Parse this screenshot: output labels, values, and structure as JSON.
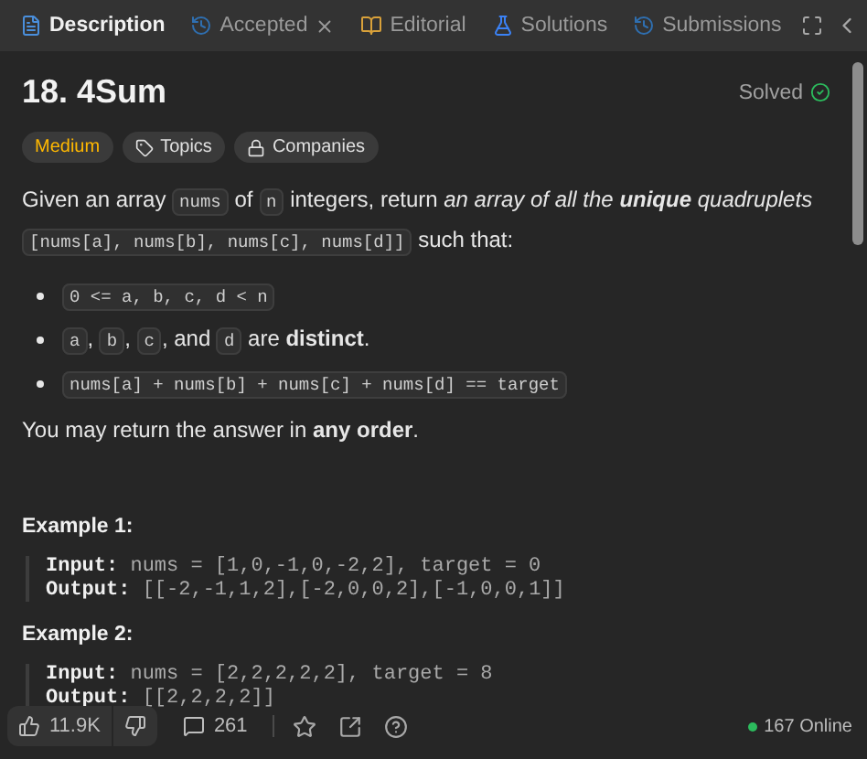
{
  "tabs": [
    {
      "label": "Description",
      "kind": "description",
      "selected": true,
      "closable": false
    },
    {
      "label": "Accepted",
      "kind": "accepted",
      "selected": false,
      "closable": true
    },
    {
      "label": "Editorial",
      "kind": "editorial",
      "selected": false,
      "closable": false
    },
    {
      "label": "Solutions",
      "kind": "solutions",
      "selected": false,
      "closable": false
    },
    {
      "label": "Submissions",
      "kind": "submissions",
      "selected": false,
      "closable": false
    }
  ],
  "problem": {
    "title": "18. 4Sum",
    "status": "Solved",
    "tags": [
      {
        "kind": "difficulty",
        "label": "Medium"
      },
      {
        "kind": "topics",
        "label": "Topics"
      },
      {
        "kind": "companies",
        "label": "Companies"
      }
    ],
    "intro": [
      {
        "kind": "text",
        "text": "Given an array "
      },
      {
        "kind": "code",
        "text": "nums"
      },
      {
        "kind": "text",
        "text": " of "
      },
      {
        "kind": "code",
        "text": "n"
      },
      {
        "kind": "text",
        "text": " integers, return "
      },
      {
        "kind": "italic",
        "text": "an array of all the **unique** quadruplets "
      },
      {
        "kind": "code",
        "text": "[nums[a], nums[b], nums[c], nums[d]]"
      },
      {
        "kind": "text",
        "text": " such that:"
      }
    ],
    "conditions": [
      [
        {
          "kind": "code",
          "text": "0 <= a, b, c, d < n"
        }
      ],
      [
        {
          "kind": "code",
          "text": "a"
        },
        {
          "kind": "text",
          "text": ", "
        },
        {
          "kind": "code",
          "text": "b"
        },
        {
          "kind": "text",
          "text": ", "
        },
        {
          "kind": "code",
          "text": "c"
        },
        {
          "kind": "text",
          "text": ", and "
        },
        {
          "kind": "code",
          "text": "d"
        },
        {
          "kind": "text",
          "text": " are **distinct**."
        }
      ],
      [
        {
          "kind": "code",
          "text": "nums[a] + nums[b] + nums[c] + nums[d] == target"
        }
      ]
    ],
    "note": [
      {
        "kind": "text",
        "text": "You may return the answer in **any order**."
      }
    ],
    "examples": [
      {
        "title": "Example 1:",
        "lines": [
          {
            "label": "Input:",
            "value": "nums = [1,0,-1,0,-2,2], target = 0"
          },
          {
            "label": "Output:",
            "value": "[[-2,-1,1,2],[-2,0,0,2],[-1,0,0,1]]"
          }
        ]
      },
      {
        "title": "Example 2:",
        "lines": [
          {
            "label": "Input:",
            "value": "nums = [2,2,2,2,2], target = 8"
          },
          {
            "label": "Output:",
            "value": "[[2,2,2,2]]"
          }
        ]
      }
    ]
  },
  "footer": {
    "likes": "11.9K",
    "comments": "261",
    "online": "167 Online"
  }
}
